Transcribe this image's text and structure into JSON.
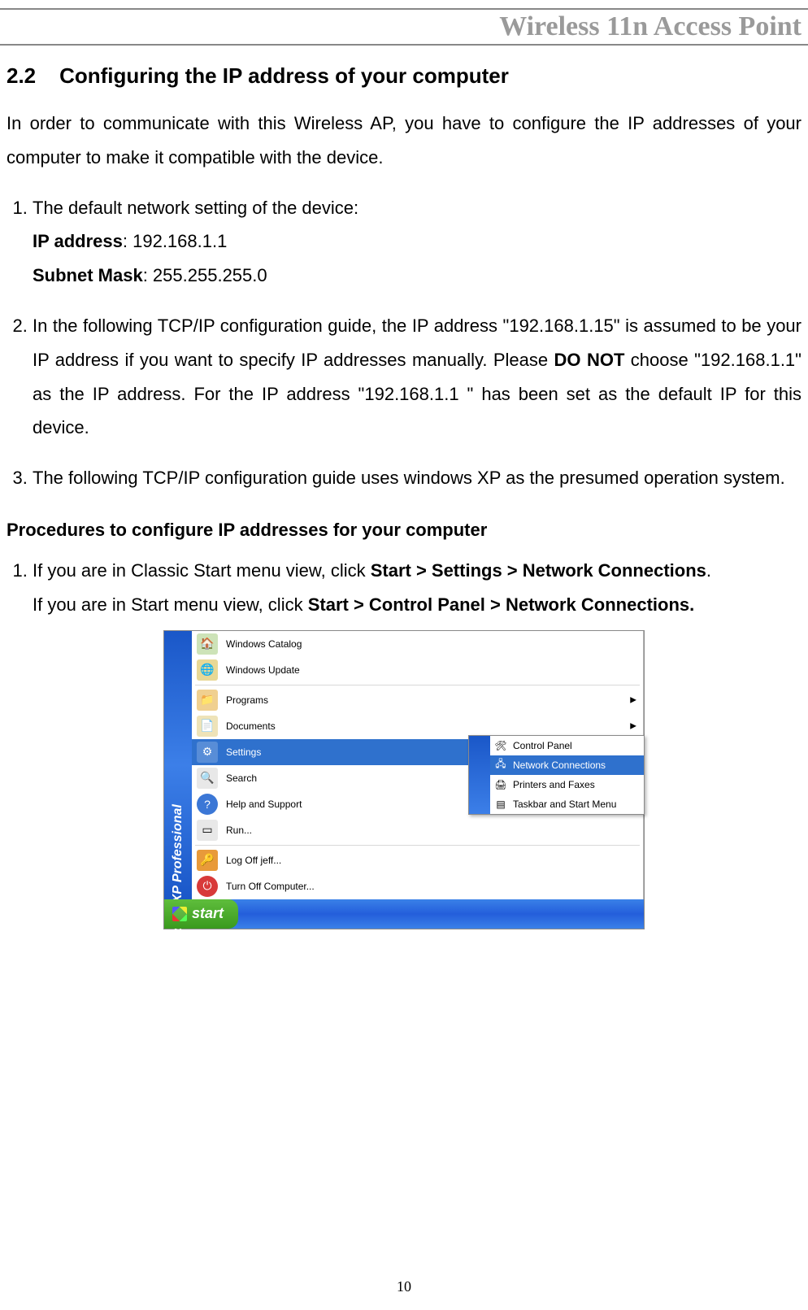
{
  "header": {
    "title": "Wireless 11n Access Point"
  },
  "section": {
    "number": "2.2",
    "title": "Configuring the IP address of your computer"
  },
  "intro": "In order to communicate with this Wireless AP, you have to configure the IP addresses of your computer to make it compatible with the device.",
  "list1": {
    "item1": {
      "lead": "The default network setting of the device:",
      "ip_label": "IP address",
      "ip_value": ": 192.168.1.1",
      "mask_label": "Subnet Mask",
      "mask_value": ": 255.255.255.0"
    },
    "item2_a": "In the following TCP/IP configuration guide, the IP address \"192.168.1.15\" is assumed to be your IP address if you want to specify IP addresses manually. Please ",
    "item2_b": "DO NOT",
    "item2_c": " choose \"192.168.1.1\" as the IP address. For the IP address \"192.168.1.1 \" has been set as the default IP for this device.",
    "item3": "The following TCP/IP configuration guide uses windows XP as the presumed operation system."
  },
  "procedures_title": "Procedures to configure IP addresses for your computer",
  "proc": {
    "item1a": "If you are in Classic Start menu view, click ",
    "item1a_bold": "Start > Settings > Network Connections",
    "item1a_end": ".",
    "item1b": "If you are in Start menu view, click ",
    "item1b_bold": "Start > Control Panel > Network Connections."
  },
  "menu": {
    "left_bar": "Windows XP Professional",
    "items": [
      "Windows Catalog",
      "Windows Update",
      "Programs",
      "Documents",
      "Settings",
      "Search",
      "Help and Support",
      "Run...",
      "Log Off jeff...",
      "Turn Off Computer..."
    ],
    "submenu": [
      "Control Panel",
      "Network Connections",
      "Printers and Faxes",
      "Taskbar and Start Menu"
    ],
    "start": "start"
  },
  "page_number": "10"
}
